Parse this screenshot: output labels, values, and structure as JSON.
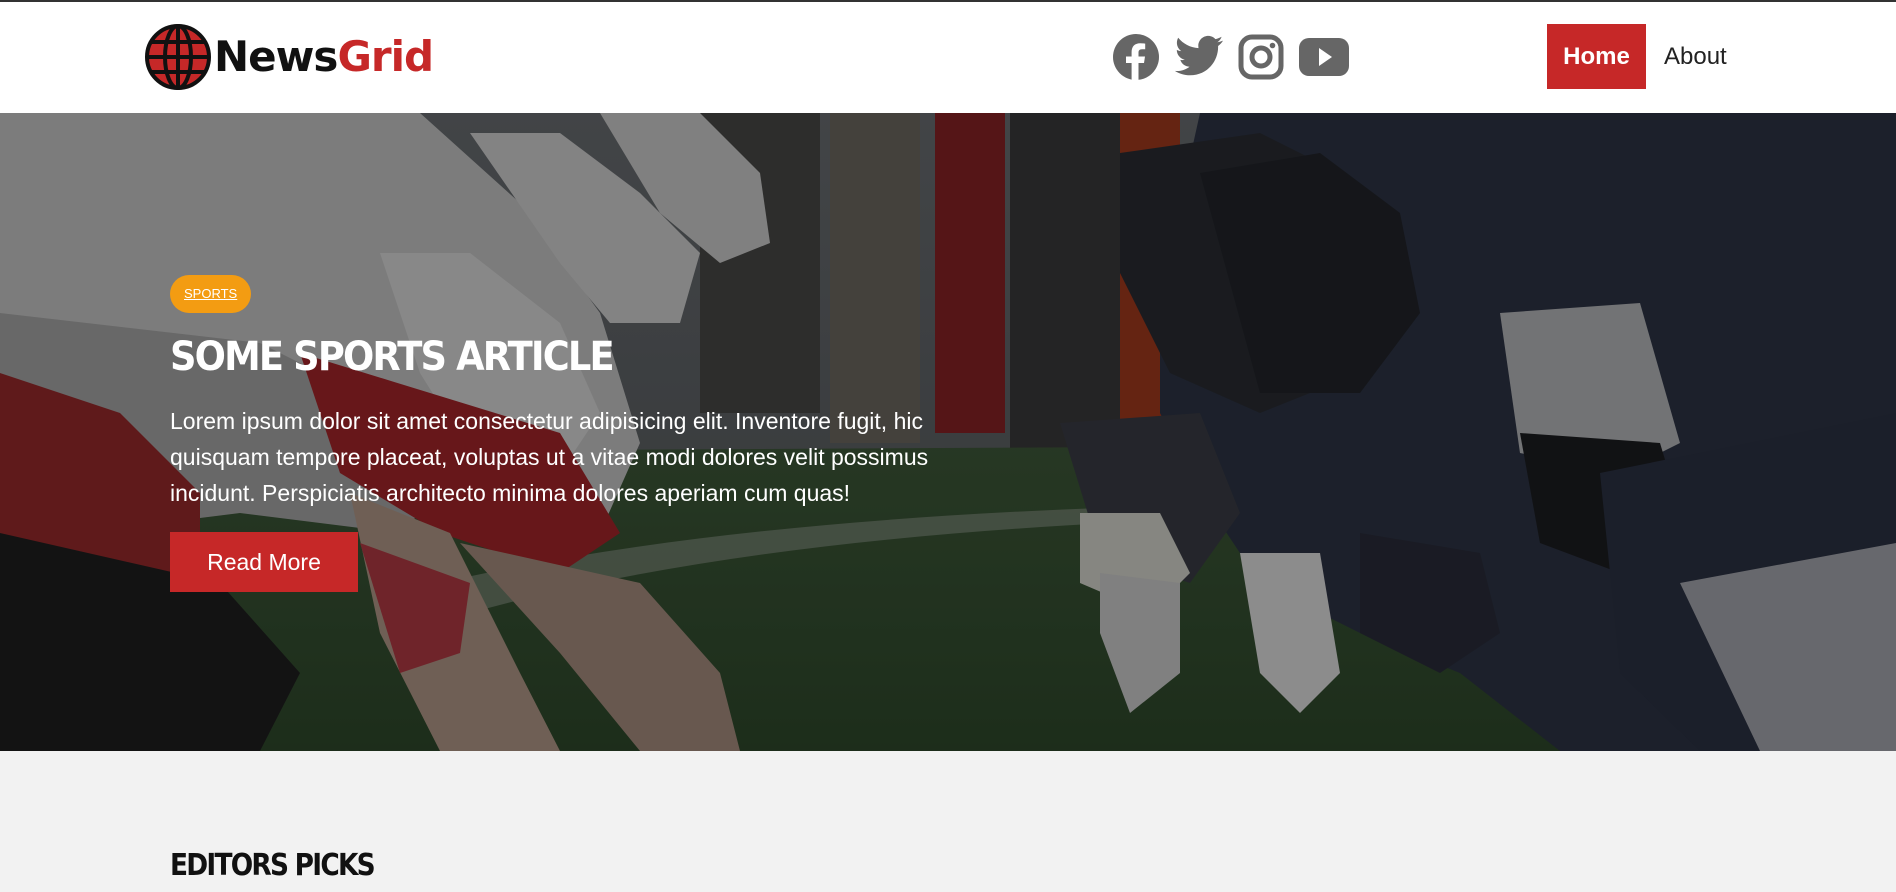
{
  "brand": {
    "name_part1": "News",
    "name_part2": "Grid"
  },
  "social": [
    {
      "icon": "facebook-icon"
    },
    {
      "icon": "twitter-icon"
    },
    {
      "icon": "instagram-icon"
    },
    {
      "icon": "youtube-icon"
    }
  ],
  "nav": {
    "home": "Home",
    "about": "About",
    "active": "Home"
  },
  "hero": {
    "category": "SPORTS",
    "title": "Some Sports Article",
    "text": "Lorem ipsum dolor sit amet consectetur adipisicing elit. Inventore fugit, hic quisquam tempore placeat, voluptas ut a vitae modi dolores velit possimus incidunt. Perspiciatis architecto minima dolores aperiam cum quas!",
    "button": "Read More"
  },
  "section": {
    "title": "Editors Picks"
  },
  "colors": {
    "accent": "#c62828",
    "badge": "#f39c12",
    "icon_gray": "#666666"
  }
}
